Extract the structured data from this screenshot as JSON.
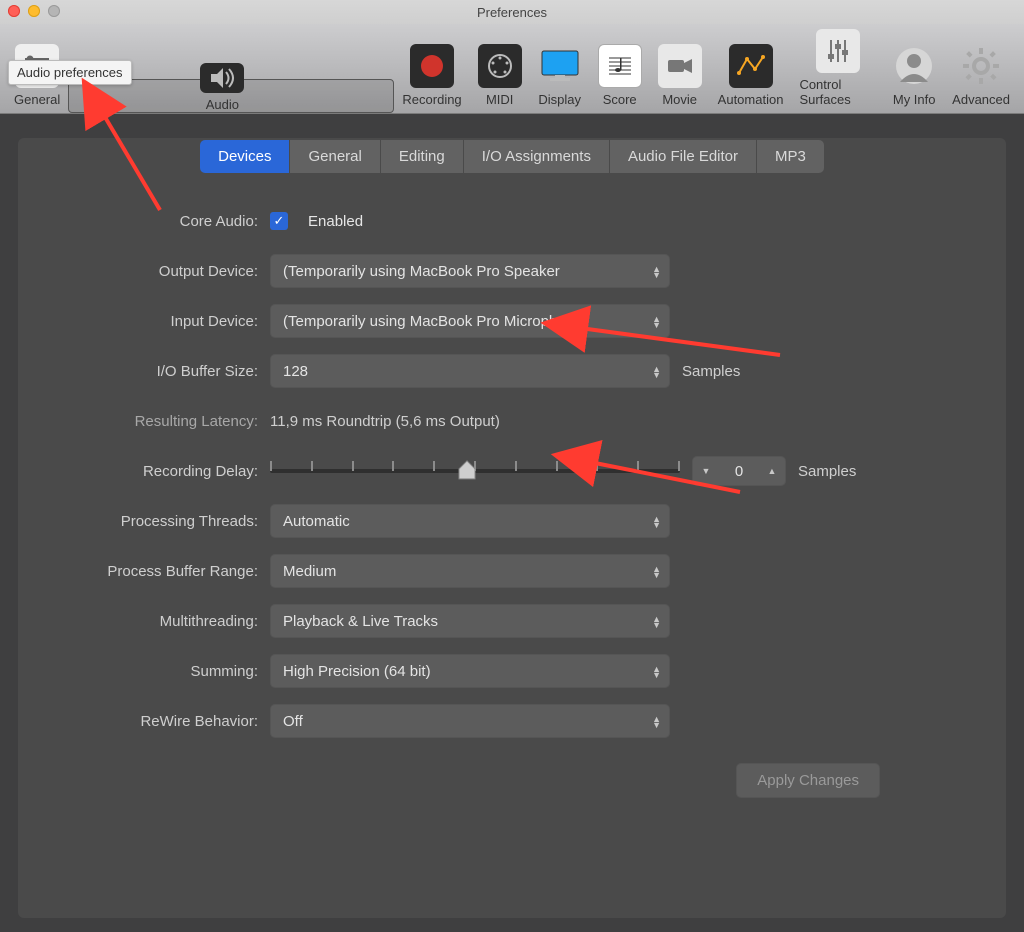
{
  "window": {
    "title": "Preferences"
  },
  "tooltip": {
    "text": "Audio preferences"
  },
  "toolbar": {
    "items": [
      {
        "id": "general",
        "label": "General"
      },
      {
        "id": "audio",
        "label": "Audio"
      },
      {
        "id": "recording",
        "label": "Recording"
      },
      {
        "id": "midi",
        "label": "MIDI"
      },
      {
        "id": "display",
        "label": "Display"
      },
      {
        "id": "score",
        "label": "Score"
      },
      {
        "id": "movie",
        "label": "Movie"
      },
      {
        "id": "automation",
        "label": "Automation"
      },
      {
        "id": "control",
        "label": "Control Surfaces"
      },
      {
        "id": "myinfo",
        "label": "My Info"
      },
      {
        "id": "advanced",
        "label": "Advanced"
      }
    ]
  },
  "tabs": {
    "items": [
      {
        "id": "devices",
        "label": "Devices",
        "active": true
      },
      {
        "id": "general",
        "label": "General"
      },
      {
        "id": "editing",
        "label": "Editing"
      },
      {
        "id": "io",
        "label": "I/O Assignments"
      },
      {
        "id": "afe",
        "label": "Audio File Editor"
      },
      {
        "id": "mp3",
        "label": "MP3"
      }
    ]
  },
  "form": {
    "core_audio_label": "Core Audio:",
    "core_audio_enabled_label": "Enabled",
    "output_label": "Output Device:",
    "output_value": "(Temporarily using MacBook Pro Speaker",
    "input_label": "Input Device:",
    "input_value": "(Temporarily using MacBook Pro Microph",
    "iobuf_label": "I/O Buffer Size:",
    "iobuf_value": "128",
    "iobuf_suffix": "Samples",
    "latency_label": "Resulting Latency:",
    "latency_value": "11,9 ms Roundtrip (5,6 ms Output)",
    "recdelay_label": "Recording Delay:",
    "recdelay_value": "0",
    "recdelay_suffix": "Samples",
    "threads_label": "Processing Threads:",
    "threads_value": "Automatic",
    "pbr_label": "Process Buffer Range:",
    "pbr_value": "Medium",
    "mt_label": "Multithreading:",
    "mt_value": "Playback & Live Tracks",
    "sum_label": "Summing:",
    "sum_value": "High Precision (64 bit)",
    "rewire_label": "ReWire Behavior:",
    "rewire_value": "Off",
    "apply_label": "Apply Changes"
  },
  "annotations": {
    "arrow_to_audio_tab": true,
    "arrow_to_io_buffer": true,
    "arrow_to_threads": true,
    "color": "#ff3b30"
  }
}
